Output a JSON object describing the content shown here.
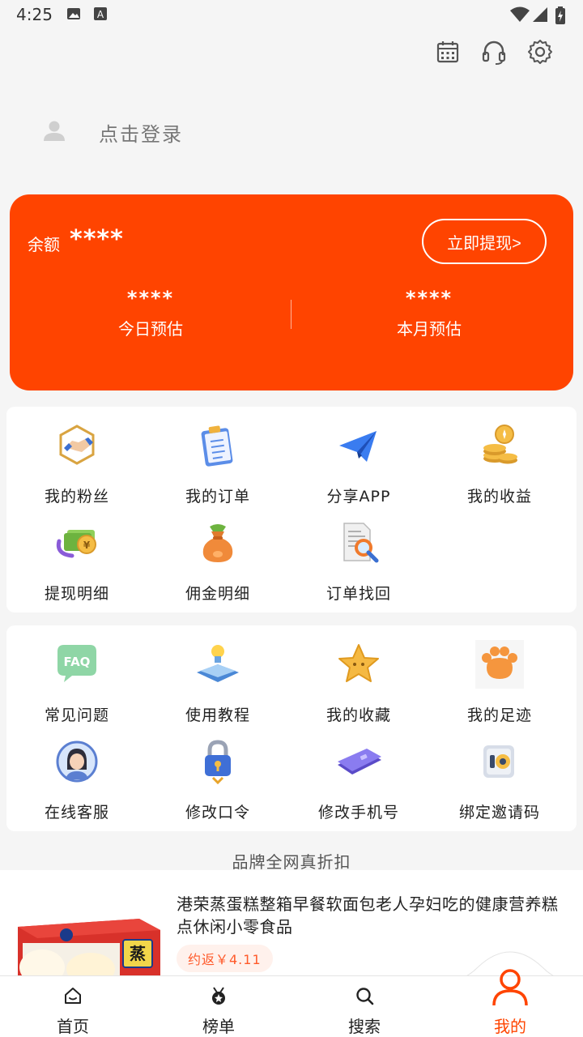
{
  "status_bar": {
    "time": "4:25"
  },
  "header": {
    "icons": [
      "calendar-icon",
      "headset-icon",
      "settings-icon"
    ]
  },
  "login": {
    "text": "点击登录"
  },
  "balance_card": {
    "balance_label": "余额",
    "balance_value": "****",
    "withdraw_button": "立即提现>",
    "today": {
      "value": "****",
      "label": "今日预估"
    },
    "month": {
      "value": "****",
      "label": "本月预估"
    },
    "color": "#ff4400"
  },
  "grid1": {
    "items": [
      {
        "label": "我的粉丝",
        "icon": "handshake-icon"
      },
      {
        "label": "我的订单",
        "icon": "clipboard-icon"
      },
      {
        "label": "分享APP",
        "icon": "paper-plane-icon"
      },
      {
        "label": "我的收益",
        "icon": "coins-icon"
      },
      {
        "label": "提现明细",
        "icon": "money-icon"
      },
      {
        "label": "佣金明细",
        "icon": "money-bag-icon"
      },
      {
        "label": "订单找回",
        "icon": "document-search-icon"
      }
    ]
  },
  "grid2": {
    "items": [
      {
        "label": "常见问题",
        "icon": "faq-icon"
      },
      {
        "label": "使用教程",
        "icon": "book-lightbulb-icon"
      },
      {
        "label": "我的收藏",
        "icon": "star-icon"
      },
      {
        "label": "我的足迹",
        "icon": "paw-icon"
      },
      {
        "label": "在线客服",
        "icon": "customer-service-icon"
      },
      {
        "label": "修改口令",
        "icon": "padlock-icon"
      },
      {
        "label": "修改手机号",
        "icon": "phone-card-icon"
      },
      {
        "label": "绑定邀请码",
        "icon": "invite-code-icon"
      }
    ]
  },
  "section_title": "品牌全网真折扣",
  "product": {
    "title": "港荣蒸蛋糕整箱早餐软面包老人孕妇吃的健康营养糕点休闲小零食品",
    "rebate": "约返￥4.11",
    "thumb_text": "蒸"
  },
  "tabbar": {
    "tabs": [
      {
        "label": "首页",
        "icon": "home-icon"
      },
      {
        "label": "榜单",
        "icon": "medal-icon"
      },
      {
        "label": "搜索",
        "icon": "search-icon"
      },
      {
        "label": "我的",
        "icon": "user-icon",
        "active": true
      }
    ]
  }
}
